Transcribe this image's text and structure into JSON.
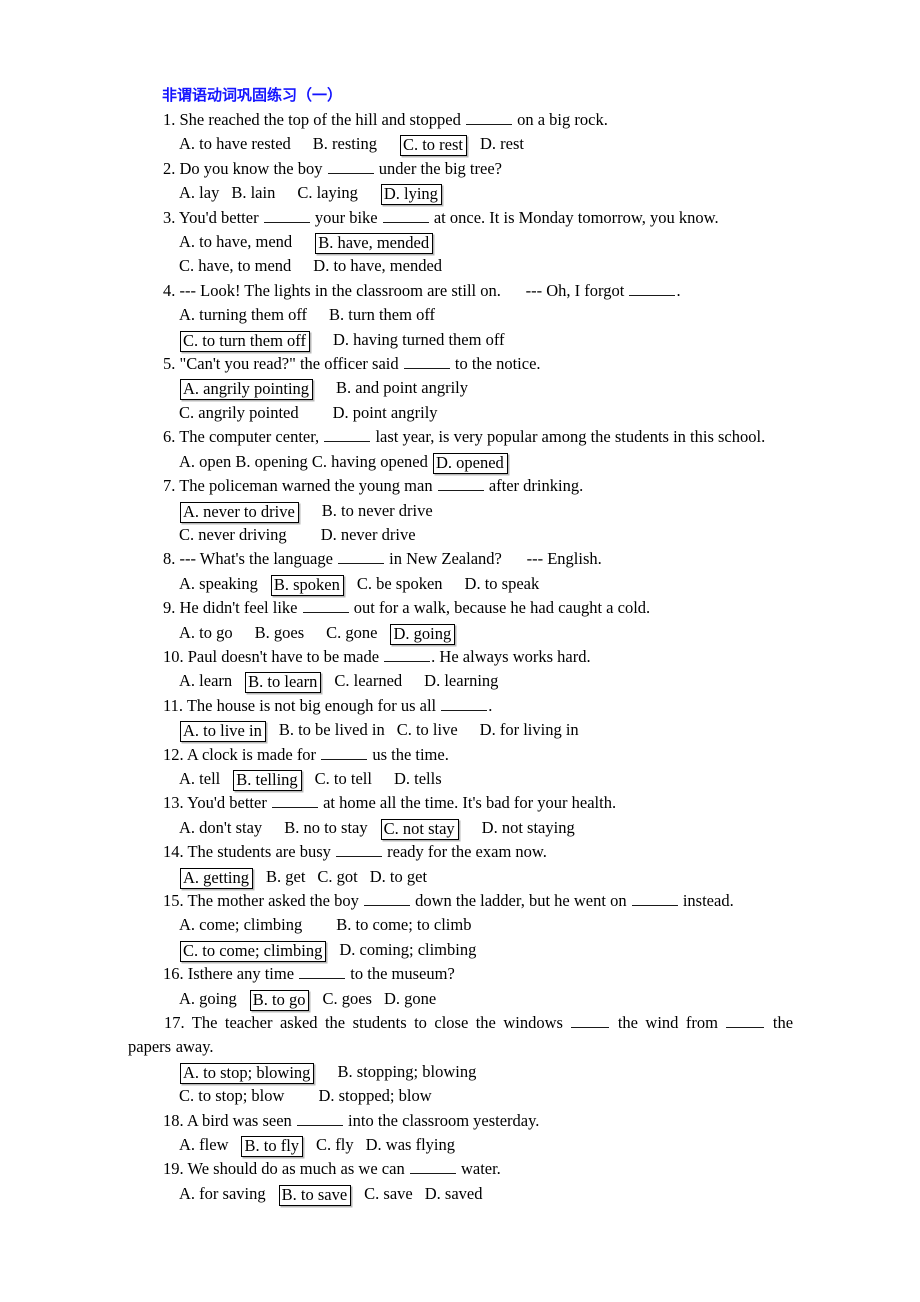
{
  "document": {
    "title": "非谓语动词巩固练习（一）",
    "title_color": "#1414ff"
  },
  "questions": [
    {
      "number": "1.",
      "prompt_before": "She reached the top of the hill and stopped",
      "prompt_after": "on a big rock.",
      "lines": [
        [
          {
            "label": "A. to have rested",
            "boxed": false,
            "gap": "gap-m"
          },
          {
            "label": "B. resting",
            "boxed": false,
            "gap": "gap-m"
          },
          {
            "label": "C. to rest",
            "boxed": true,
            "gap": "gap-s"
          },
          {
            "label": "D. rest",
            "boxed": false,
            "gap": ""
          }
        ]
      ]
    },
    {
      "number": "2.",
      "prompt_before": "Do you know the boy",
      "prompt_after": "under the big tree?",
      "lines": [
        [
          {
            "label": "A. lay",
            "boxed": false,
            "gap": "gap-s"
          },
          {
            "label": "B. lain",
            "boxed": false,
            "gap": "gap-m"
          },
          {
            "label": "C. laying",
            "boxed": false,
            "gap": "gap-m"
          },
          {
            "label": "D. lying",
            "boxed": true,
            "gap": ""
          }
        ]
      ]
    },
    {
      "number": "3.",
      "prompt_before": "You'd better",
      "prompt_mid": "your bike",
      "prompt_after": "at once. It is Monday tomorrow, you know.",
      "lines": [
        [
          {
            "label": "A. to have, mend",
            "boxed": false,
            "gap": "gap-m"
          },
          {
            "label": "B. have, mended",
            "boxed": true,
            "gap": ""
          }
        ],
        [
          {
            "label": "C. have, to mend",
            "boxed": false,
            "gap": "gap-m"
          },
          {
            "label": "D. to have, mended",
            "boxed": false,
            "gap": ""
          }
        ]
      ]
    },
    {
      "number": "4.",
      "prompt_before": "--- Look! The lights in the classroom are still on.",
      "prompt_mid2": "--- Oh, I forgot",
      "prompt_after": ".",
      "lines": [
        [
          {
            "label": "A. turning them off",
            "boxed": false,
            "gap": "gap-m"
          },
          {
            "label": "B. turn them off",
            "boxed": false,
            "gap": ""
          }
        ],
        [
          {
            "label": "C. to turn them off",
            "boxed": true,
            "gap": "gap-m"
          },
          {
            "label": "D. having turned them off",
            "boxed": false,
            "gap": ""
          }
        ]
      ]
    },
    {
      "number": "5.",
      "prompt_before": "\"Can't you read?\" the officer said",
      "prompt_after": "to the notice.",
      "lines": [
        [
          {
            "label": "A. angrily pointing",
            "boxed": true,
            "gap": "gap-m"
          },
          {
            "label": "B. and point angrily",
            "boxed": false,
            "gap": ""
          }
        ],
        [
          {
            "label": "C. angrily pointed",
            "boxed": false,
            "gap": "gap-l"
          },
          {
            "label": "D. point angrily",
            "boxed": false,
            "gap": ""
          }
        ]
      ]
    },
    {
      "number": "6.",
      "prompt_before": "The computer center,",
      "prompt_after": "last year, is very popular among the students in this school.",
      "lines": [
        [
          {
            "label": "A. open",
            "boxed": false,
            "gap": "",
            "space": true
          },
          {
            "label": "B. opening",
            "boxed": false,
            "gap": "",
            "space": true
          },
          {
            "label": "C. having opened",
            "boxed": false,
            "gap": "",
            "space": true
          },
          {
            "label": "D. opened",
            "boxed": true,
            "gap": ""
          }
        ]
      ]
    },
    {
      "number": "7.",
      "prompt_before": "The policeman warned the young man",
      "prompt_after": "after drinking.",
      "lines": [
        [
          {
            "label": "A. never to drive",
            "boxed": true,
            "gap": "gap-m"
          },
          {
            "label": "B. to never drive",
            "boxed": false,
            "gap": ""
          }
        ],
        [
          {
            "label": "C. never driving",
            "boxed": false,
            "gap": "gap-l"
          },
          {
            "label": "D. never drive",
            "boxed": false,
            "gap": ""
          }
        ]
      ]
    },
    {
      "number": "8.",
      "prompt_before": "--- What's the language",
      "prompt_after": "in New Zealand?",
      "prompt_tail": "--- English.",
      "lines": [
        [
          {
            "label": "A. speaking",
            "boxed": false,
            "gap": "gap-s"
          },
          {
            "label": "B. spoken",
            "boxed": true,
            "gap": "gap-s"
          },
          {
            "label": "C. be spoken",
            "boxed": false,
            "gap": "gap-m"
          },
          {
            "label": "D. to speak",
            "boxed": false,
            "gap": ""
          }
        ]
      ]
    },
    {
      "number": "9.",
      "prompt_before": "He didn't feel like",
      "prompt_after": "out for a walk, because he had caught a cold.",
      "lines": [
        [
          {
            "label": "A. to go",
            "boxed": false,
            "gap": "gap-m"
          },
          {
            "label": "B. goes",
            "boxed": false,
            "gap": "gap-m"
          },
          {
            "label": "C. gone",
            "boxed": false,
            "gap": "gap-s"
          },
          {
            "label": "D. going",
            "boxed": true,
            "gap": ""
          }
        ]
      ]
    },
    {
      "number": "10.",
      "prompt_before": "Paul doesn't have to be made",
      "prompt_after": ". He always works hard.",
      "lines": [
        [
          {
            "label": "A. learn",
            "boxed": false,
            "gap": "gap-s"
          },
          {
            "label": "B. to learn",
            "boxed": true,
            "gap": "gap-s"
          },
          {
            "label": "C. learned",
            "boxed": false,
            "gap": "gap-m"
          },
          {
            "label": "D. learning",
            "boxed": false,
            "gap": ""
          }
        ]
      ]
    },
    {
      "number": "11.",
      "prompt_before": "The house is not big enough for us all",
      "prompt_after": ".",
      "lines": [
        [
          {
            "label": "A. to live in",
            "boxed": true,
            "gap": "gap-s"
          },
          {
            "label": "B. to be lived in",
            "boxed": false,
            "gap": "gap-s"
          },
          {
            "label": "C. to live",
            "boxed": false,
            "gap": "gap-m"
          },
          {
            "label": "D. for living in",
            "boxed": false,
            "gap": ""
          }
        ]
      ]
    },
    {
      "number": "12.",
      "prompt_before": "A clock is made for",
      "prompt_after": "us the time.",
      "lines": [
        [
          {
            "label": "A. tell",
            "boxed": false,
            "gap": "gap-s"
          },
          {
            "label": "B. telling",
            "boxed": true,
            "gap": "gap-s"
          },
          {
            "label": "C. to tell",
            "boxed": false,
            "gap": "gap-m"
          },
          {
            "label": "D. tells",
            "boxed": false,
            "gap": ""
          }
        ]
      ]
    },
    {
      "number": "13.",
      "prompt_before": "You'd better",
      "prompt_after": "at home all the time. It's bad for your health.",
      "lines": [
        [
          {
            "label": "A. don't stay",
            "boxed": false,
            "gap": "gap-m"
          },
          {
            "label": "B. no to stay",
            "boxed": false,
            "gap": "gap-s"
          },
          {
            "label": "C. not stay",
            "boxed": true,
            "gap": "gap-m"
          },
          {
            "label": "D. not staying",
            "boxed": false,
            "gap": ""
          }
        ]
      ]
    },
    {
      "number": "14.",
      "prompt_before": "The students are busy",
      "prompt_after": "ready for the exam now.",
      "lines": [
        [
          {
            "label": "A. getting",
            "boxed": true,
            "gap": "gap-s"
          },
          {
            "label": "B. get",
            "boxed": false,
            "gap": "gap-s"
          },
          {
            "label": "C. got",
            "boxed": false,
            "gap": "gap-s"
          },
          {
            "label": "D. to get",
            "boxed": false,
            "gap": ""
          }
        ]
      ]
    },
    {
      "number": "15.",
      "prompt_before": "The mother asked the boy",
      "prompt_mid": "down the ladder, but he went on",
      "prompt_after": "instead.",
      "lines": [
        [
          {
            "label": "A. come; climbing",
            "boxed": false,
            "gap": "gap-l"
          },
          {
            "label": "B. to come; to climb",
            "boxed": false,
            "gap": ""
          }
        ],
        [
          {
            "label": "C. to come; climbing",
            "boxed": true,
            "gap": "gap-s"
          },
          {
            "label": "D. coming; climbing",
            "boxed": false,
            "gap": ""
          }
        ]
      ]
    },
    {
      "number": "16.",
      "prompt_before": "Isthere any time",
      "prompt_after": "to the museum?",
      "lines": [
        [
          {
            "label": "A. going",
            "boxed": false,
            "gap": "gap-s"
          },
          {
            "label": "B. to go",
            "boxed": true,
            "gap": "gap-s"
          },
          {
            "label": "C. goes",
            "boxed": false,
            "gap": "gap-s"
          },
          {
            "label": "D. gone",
            "boxed": false,
            "gap": ""
          }
        ]
      ]
    },
    {
      "number": "17.",
      "prompt_before": "The teacher asked the students to close the windows",
      "prompt_mid": "the wind from",
      "prompt_after": "the papers away.",
      "wrapping": true,
      "lines": [
        [
          {
            "label": "A. to stop; blowing",
            "boxed": true,
            "gap": "gap-m"
          },
          {
            "label": "B. stopping; blowing",
            "boxed": false,
            "gap": ""
          }
        ],
        [
          {
            "label": "C. to stop; blow",
            "boxed": false,
            "gap": "gap-l"
          },
          {
            "label": "D. stopped; blow",
            "boxed": false,
            "gap": ""
          }
        ]
      ]
    },
    {
      "number": "18.",
      "prompt_before": "A bird was seen",
      "prompt_after": "into the classroom yesterday.",
      "lines": [
        [
          {
            "label": "A. flew",
            "boxed": false,
            "gap": "gap-s"
          },
          {
            "label": "B. to fly",
            "boxed": true,
            "gap": "gap-s"
          },
          {
            "label": "C. fly",
            "boxed": false,
            "gap": "gap-s"
          },
          {
            "label": "D. was flying",
            "boxed": false,
            "gap": ""
          }
        ]
      ]
    },
    {
      "number": "19.",
      "prompt_before": "We should do as much as we can",
      "prompt_after": "water.",
      "lines": [
        [
          {
            "label": "A. for saving",
            "boxed": false,
            "gap": "gap-s"
          },
          {
            "label": "B. to save",
            "boxed": true,
            "gap": "gap-s"
          },
          {
            "label": "C. save",
            "boxed": false,
            "gap": "gap-s"
          },
          {
            "label": "D. saved",
            "boxed": false,
            "gap": ""
          }
        ]
      ]
    }
  ]
}
